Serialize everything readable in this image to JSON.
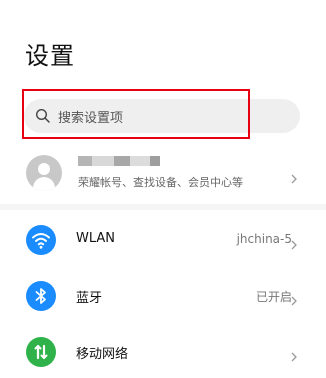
{
  "header": {
    "title": "设置"
  },
  "search": {
    "placeholder": "搜索设置项",
    "icon": "search-icon"
  },
  "account": {
    "subtitle": "荣耀帐号、查找设备、会员中心等",
    "icon": "avatar-icon"
  },
  "settings": [
    {
      "label": "WLAN",
      "value": "jhchina-5",
      "icon": "wifi-icon",
      "color": "#1a8cff"
    },
    {
      "label": "蓝牙",
      "value": "已开启",
      "icon": "bluetooth-icon",
      "color": "#1a8cff"
    },
    {
      "label": "移动网络",
      "value": "",
      "icon": "mobile-network-icon",
      "color": "#2fb24a"
    }
  ],
  "colors": {
    "highlight": "#e60012",
    "accent_blue": "#1a8cff",
    "accent_green": "#2fb24a"
  }
}
